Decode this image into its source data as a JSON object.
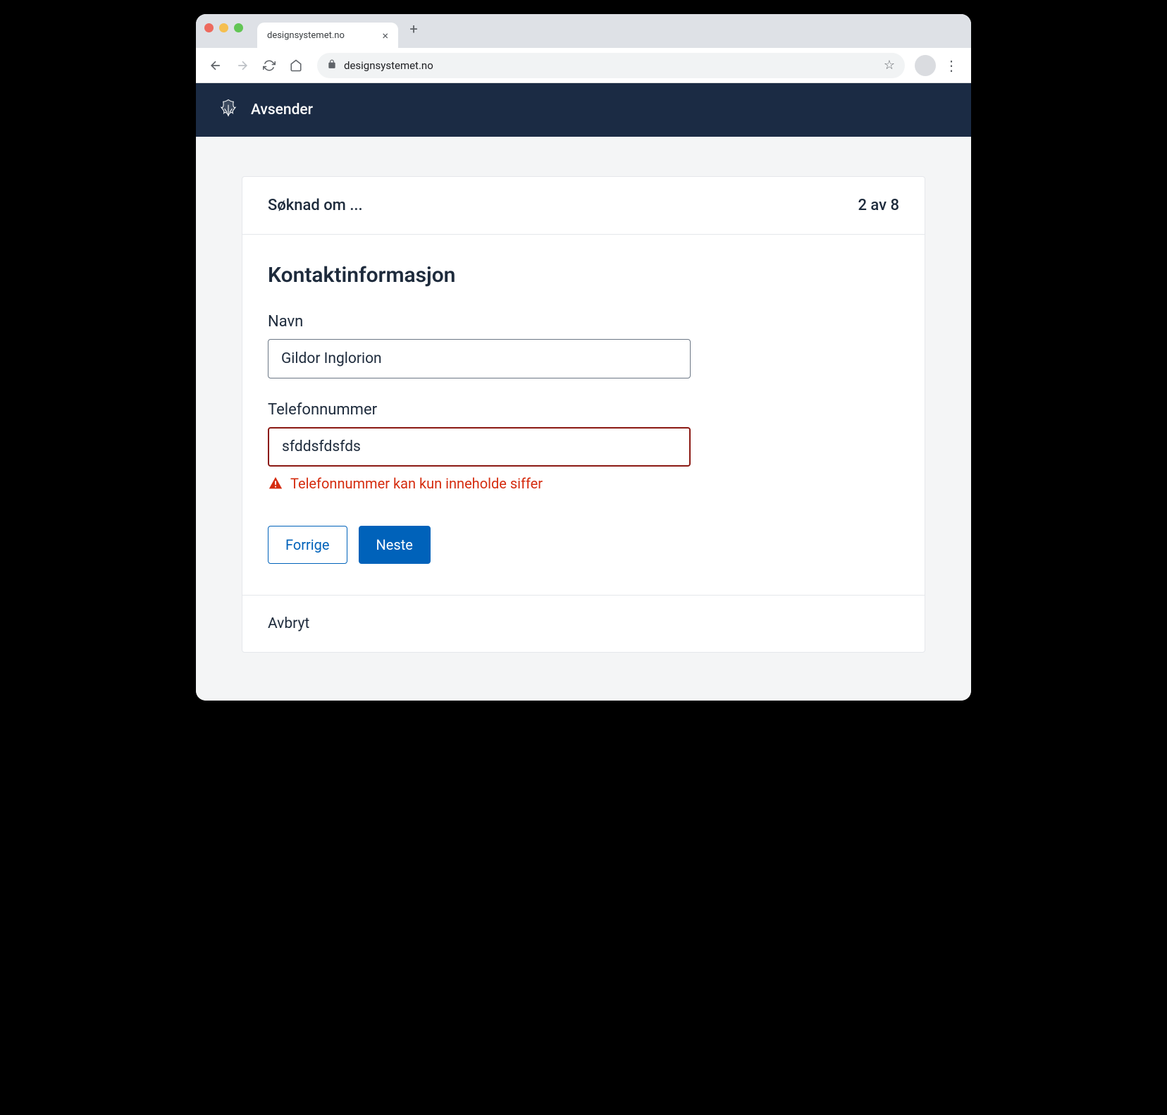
{
  "browser": {
    "tab_title": "designsystemet.no",
    "url": "designsystemet.no"
  },
  "app_header": {
    "title": "Avsender"
  },
  "form": {
    "header_title": "Søknad om ...",
    "step_indicator": "2 av 8",
    "heading": "Kontaktinformasjon",
    "name": {
      "label": "Navn",
      "value": "Gildor Inglorion"
    },
    "phone": {
      "label": "Telefonnummer",
      "value": "sfddsfdsfds",
      "error": "Telefonnummer kan kun inneholde siffer"
    },
    "buttons": {
      "previous": "Forrige",
      "next": "Neste",
      "cancel": "Avbryt"
    }
  }
}
